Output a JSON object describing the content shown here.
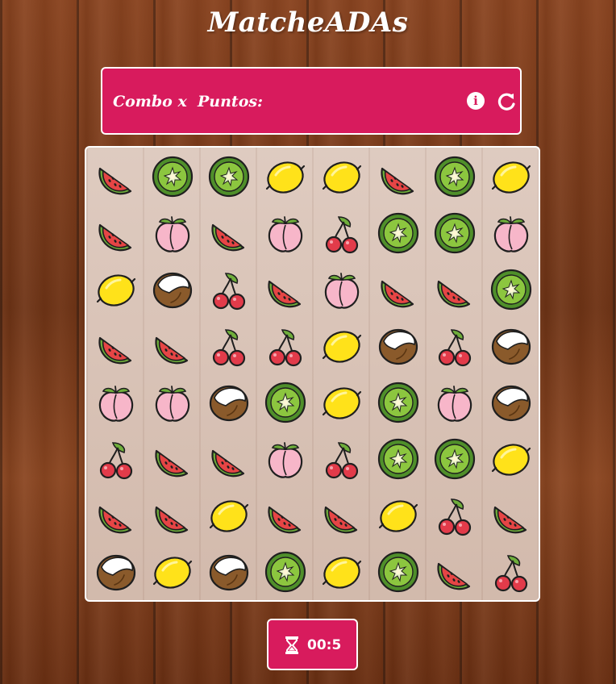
{
  "header": {
    "title": "MatcheADAs"
  },
  "status": {
    "combo_label": "Combo x",
    "points_label": "Puntos:",
    "info_icon": "info-icon",
    "reload_icon": "reload-icon"
  },
  "board": {
    "rows": [
      [
        "watermelon",
        "kiwi",
        "kiwi",
        "lemon",
        "lemon",
        "watermelon",
        "kiwi",
        "lemon"
      ],
      [
        "watermelon",
        "peach",
        "watermelon",
        "peach",
        "cherry",
        "kiwi",
        "kiwi",
        "peach"
      ],
      [
        "lemon",
        "coconut",
        "cherry",
        "watermelon",
        "peach",
        "watermelon",
        "watermelon",
        "kiwi"
      ],
      [
        "watermelon",
        "watermelon",
        "cherry",
        "cherry",
        "lemon",
        "coconut",
        "cherry",
        "coconut"
      ],
      [
        "peach",
        "peach",
        "coconut",
        "kiwi",
        "lemon",
        "kiwi",
        "peach",
        "coconut"
      ],
      [
        "cherry",
        "watermelon",
        "watermelon",
        "peach",
        "cherry",
        "kiwi",
        "kiwi",
        "lemon"
      ],
      [
        "watermelon",
        "watermelon",
        "lemon",
        "watermelon",
        "watermelon",
        "lemon",
        "cherry",
        "watermelon"
      ],
      [
        "coconut",
        "lemon",
        "coconut",
        "kiwi",
        "lemon",
        "kiwi",
        "watermelon",
        "cherry"
      ]
    ]
  },
  "timer": {
    "icon": "hourglass-icon",
    "value": "00:5"
  },
  "colors": {
    "accent": "#d81b5d",
    "border": "#ffffff"
  }
}
